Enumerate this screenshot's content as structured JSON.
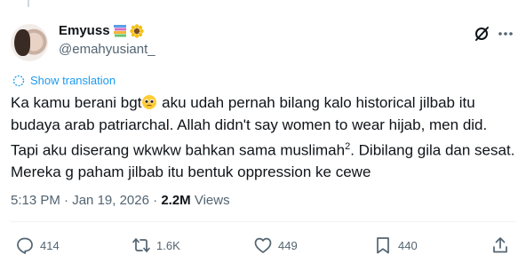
{
  "author": {
    "display_name": "Emyuss",
    "handle": "@emahyusiant_"
  },
  "translate_label": "Show translation",
  "tweet": {
    "line1_a": "Ka kamu berani bgt",
    "line1_b": " aku udah pernah bilang kalo historical jilbab itu budaya arab patriarchal. Allah didn't say women to wear hijab, men did. Tapi aku diserang wkwkw bahkan sama muslimah",
    "superscript": "2",
    "line_end": ". Dibilang gila dan sesat. Mereka g paham jilbab itu bentuk oppression ke cewe"
  },
  "meta": {
    "time": "5:13 PM",
    "separator": " · ",
    "date": "Jan 19, 2026",
    "views_count": "2.2M",
    "views_label": "Views"
  },
  "actions": {
    "replies": "414",
    "reposts": "1.6K",
    "likes": "449",
    "bookmarks": "440"
  },
  "icons": [
    "reply-icon",
    "repost-icon",
    "like-icon",
    "bookmark-icon",
    "share-icon",
    "grok-icon",
    "more-icon",
    "translate-icon"
  ],
  "colors": {
    "link": "#1d9bf0",
    "secondary_text": "#536471",
    "text": "#0f1419"
  }
}
